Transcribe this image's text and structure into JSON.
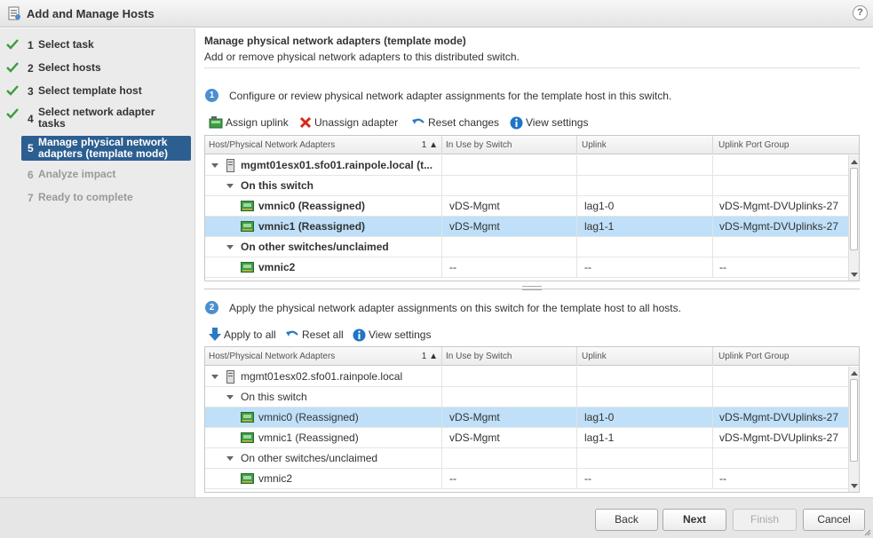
{
  "window": {
    "title": "Add and Manage Hosts",
    "help_label": "?"
  },
  "steps": [
    {
      "num": "1",
      "label": "Select task",
      "state": "done"
    },
    {
      "num": "2",
      "label": "Select hosts",
      "state": "done"
    },
    {
      "num": "3",
      "label": "Select template host",
      "state": "done"
    },
    {
      "num": "4",
      "label": "Select network adapter tasks",
      "state": "done"
    },
    {
      "num": "5",
      "label": "Manage physical network adapters (template mode)",
      "state": "active"
    },
    {
      "num": "6",
      "label": "Analyze impact",
      "state": "disabled"
    },
    {
      "num": "7",
      "label": "Ready to complete",
      "state": "disabled"
    }
  ],
  "header": {
    "title": "Manage physical network adapters (template mode)",
    "subtitle": "Add or remove physical network adapters to this distributed switch."
  },
  "section1": {
    "num": "1",
    "text": "Configure or review physical network adapter assignments for the template host in this switch.",
    "toolbar": {
      "assign": "Assign uplink",
      "unassign": "Unassign adapter",
      "reset": "Reset changes",
      "view": "View settings"
    },
    "columns": [
      "Host/Physical Network Adapters",
      "In Use by Switch",
      "Uplink",
      "Uplink Port Group"
    ],
    "sort_indicator": "1 ▲",
    "host": "mgmt01esx01.sfo01.rainpole.local (t...",
    "group_on": "On this switch",
    "rows_on": [
      {
        "name": "vmnic0 (Reassigned)",
        "switch": "vDS-Mgmt",
        "uplink": "lag1-0",
        "portgroup": "vDS-Mgmt-DVUplinks-27"
      },
      {
        "name": "vmnic1 (Reassigned)",
        "switch": "vDS-Mgmt",
        "uplink": "lag1-1",
        "portgroup": "vDS-Mgmt-DVUplinks-27"
      }
    ],
    "group_other": "On other switches/unclaimed",
    "rows_other": [
      {
        "name": "vmnic2",
        "switch": "--",
        "uplink": "--",
        "portgroup": "--"
      }
    ]
  },
  "section2": {
    "num": "2",
    "text": "Apply the physical network adapter assignments on this switch for the template host to all hosts.",
    "toolbar": {
      "apply": "Apply to all",
      "reset": "Reset all",
      "view": "View settings"
    },
    "columns": [
      "Host/Physical Network Adapters",
      "In Use by Switch",
      "Uplink",
      "Uplink Port Group"
    ],
    "sort_indicator": "1 ▲",
    "host": "mgmt01esx02.sfo01.rainpole.local",
    "group_on": "On this switch",
    "rows_on": [
      {
        "name": "vmnic0 (Reassigned)",
        "switch": "vDS-Mgmt",
        "uplink": "lag1-0",
        "portgroup": "vDS-Mgmt-DVUplinks-27"
      },
      {
        "name": "vmnic1 (Reassigned)",
        "switch": "vDS-Mgmt",
        "uplink": "lag1-1",
        "portgroup": "vDS-Mgmt-DVUplinks-27"
      }
    ],
    "group_other": "On other switches/unclaimed",
    "rows_other": [
      {
        "name": "vmnic2",
        "switch": "--",
        "uplink": "--",
        "portgroup": "--"
      }
    ]
  },
  "footer": {
    "back": "Back",
    "next": "Next",
    "finish": "Finish",
    "cancel": "Cancel"
  },
  "colors": {
    "accent": "#2c5e90",
    "selection": "#bfe0f8",
    "check": "#3c9b3c"
  }
}
